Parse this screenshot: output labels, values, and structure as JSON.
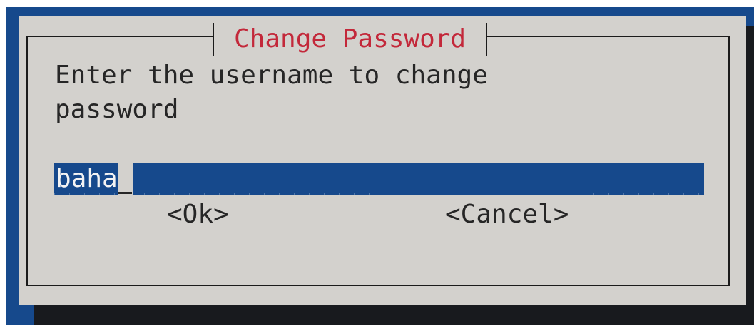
{
  "dialog": {
    "title": "Change Password",
    "prompt": "Enter the username to change\npassword",
    "input": {
      "value": "baha"
    },
    "buttons": {
      "ok": "<Ok>",
      "cancel": "<Cancel>"
    }
  },
  "colors": {
    "background": "#16498c",
    "dialog": "#d3d1cd",
    "title": "#c3283a",
    "shadow": "#181a1e",
    "text": "#262626"
  }
}
